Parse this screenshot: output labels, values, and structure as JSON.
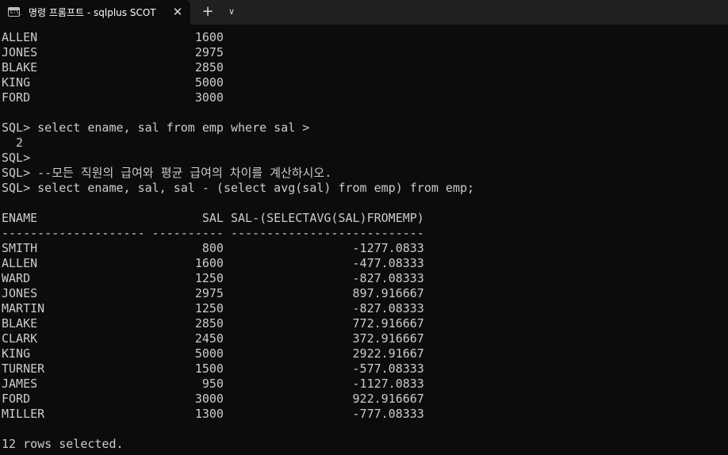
{
  "window": {
    "tab_title": "명령 프롬프트 - sqlplus  SCOT",
    "close_glyph": "✕",
    "new_tab_glyph": "+",
    "dropdown_glyph": "∨"
  },
  "console": {
    "lines": [
      "ALLEN                      1600",
      "JONES                      2975",
      "BLAKE                      2850",
      "KING                       5000",
      "FORD                       3000",
      "",
      "SQL> select ename, sal from emp where sal >",
      "  2",
      "SQL>",
      "SQL> --모든 직원의 급여와 평균 급여의 차이를 계산하시오.",
      "SQL> select ename, sal, sal - (select avg(sal) from emp) from emp;",
      "",
      "ENAME                       SAL SAL-(SELECTAVG(SAL)FROMEMP)",
      "-------------------- ---------- ---------------------------",
      "SMITH                       800                  -1277.0833",
      "ALLEN                      1600                  -477.08333",
      "WARD                       1250                  -827.08333",
      "JONES                      2975                  897.916667",
      "MARTIN                     1250                  -827.08333",
      "BLAKE                      2850                  772.916667",
      "CLARK                      2450                  372.916667",
      "KING                       5000                  2922.91667",
      "TURNER                     1500                  -577.08333",
      "JAMES                       950                  -1127.0833",
      "FORD                       3000                  922.916667",
      "MILLER                     1300                  -777.08333",
      "",
      "12 rows selected."
    ]
  }
}
